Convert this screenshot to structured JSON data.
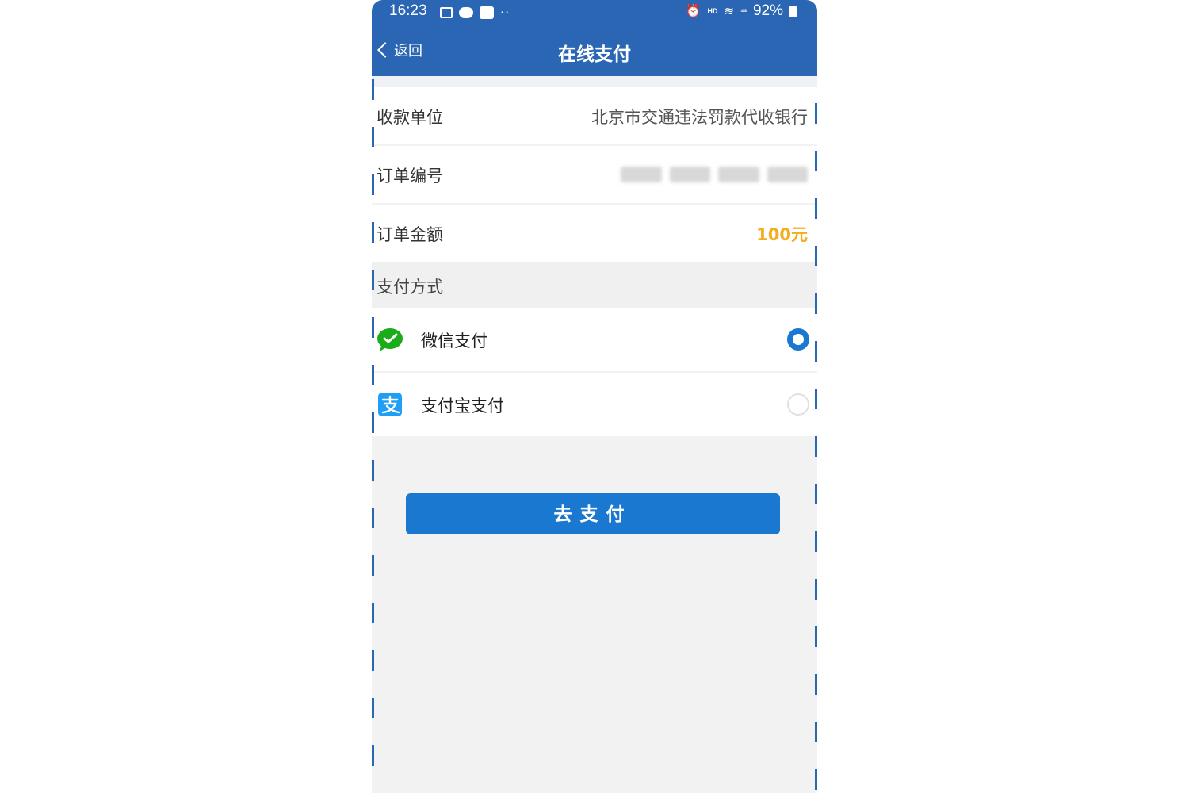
{
  "status_bar": {
    "time": "16:23",
    "battery": "92%",
    "dots": "··",
    "hd": "HD",
    "signal": "⁴ˢ"
  },
  "nav": {
    "back_label": "返回",
    "title": "在线支付"
  },
  "order": {
    "payee_label": "收款单位",
    "payee_value": "北京市交通违法罚款代收银行",
    "order_no_label": "订单编号",
    "amount_label": "订单金额",
    "amount_value": "100元"
  },
  "payment": {
    "section_label": "支付方式",
    "options": [
      {
        "label": "微信支付",
        "selected": true,
        "icon": "wechat-icon"
      },
      {
        "label": "支付宝支付",
        "selected": false,
        "icon": "alipay-icon"
      }
    ]
  },
  "actions": {
    "pay_button": "去支付"
  },
  "colors": {
    "header": "#2a66b3",
    "button": "#1a78d0",
    "amount": "#f3ad1f",
    "wechat": "#1aad19",
    "alipay": "#1e9ef4"
  }
}
